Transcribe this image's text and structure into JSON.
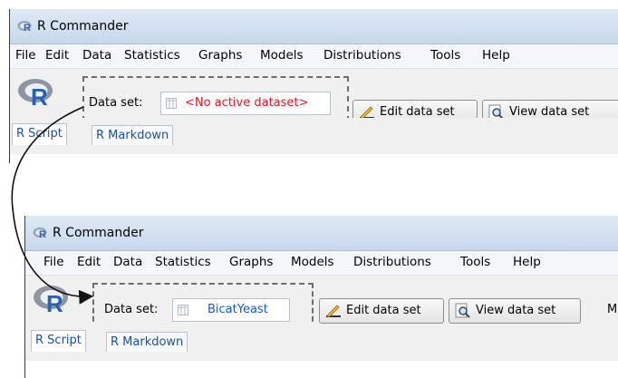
{
  "top": {
    "title": "R Commander",
    "menu": [
      "File",
      "Edit",
      "Data",
      "Statistics",
      "Graphs",
      "Models",
      "Distributions",
      "Tools",
      "Help"
    ],
    "dataset_label": "Data set:",
    "dataset_value": "<No active dataset>",
    "edit_button": "Edit data set",
    "view_button": "View data set",
    "tabs": [
      "R Script",
      "R Markdown"
    ]
  },
  "bottom": {
    "title": "R Commander",
    "menu": [
      "File",
      "Edit",
      "Data",
      "Statistics",
      "Graphs",
      "Models",
      "Distributions",
      "Tools",
      "Help"
    ],
    "dataset_label": "Data set:",
    "dataset_value": "BicatYeast",
    "edit_button": "Edit data set",
    "view_button": "View data set",
    "cut_text": "M",
    "tabs": [
      "R Script",
      "R Markdown"
    ]
  },
  "colors": {
    "no_dataset": "#e8141b",
    "active_dataset": "#1656d8",
    "dashed_box": "#6e6e6e"
  },
  "icons": [
    "r-logo-icon",
    "grid-icon",
    "pencil-icon",
    "magnifier-icon"
  ]
}
